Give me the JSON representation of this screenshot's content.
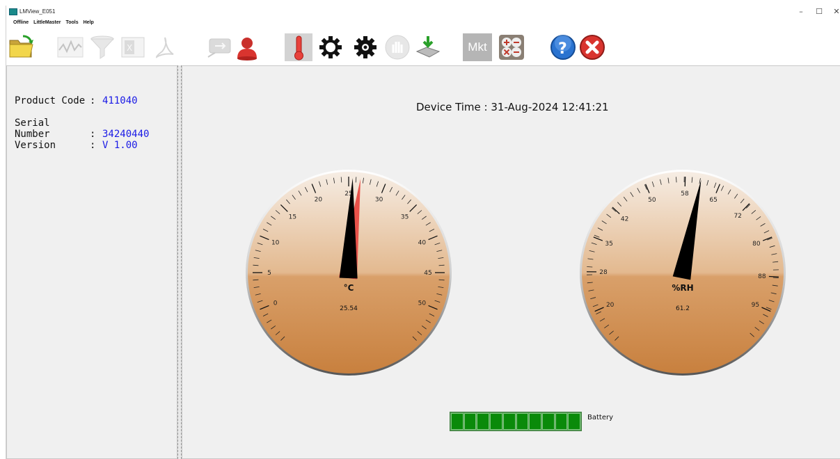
{
  "window": {
    "title": "LMView_E051",
    "minimize": "–",
    "maximize": "☐",
    "close": "✕"
  },
  "menu": [
    "Offline",
    "LittleMaster",
    "Tools",
    "Help"
  ],
  "toolbar": {
    "mkt_label": "Mkt",
    "help_glyph": "?",
    "items": [
      {
        "icon": "open-folder-icon",
        "enabled": true
      },
      {
        "icon": "graph-icon",
        "enabled": false
      },
      {
        "icon": "filter-icon",
        "enabled": false
      },
      {
        "icon": "excel-export-icon",
        "enabled": false
      },
      {
        "icon": "pdf-export-icon",
        "enabled": false
      },
      {
        "icon": "usb-device-icon",
        "enabled": false
      },
      {
        "icon": "user-icon",
        "enabled": true
      },
      {
        "icon": "thermometer-icon",
        "enabled": true,
        "active": true
      },
      {
        "icon": "settings-gear-icon",
        "enabled": true
      },
      {
        "icon": "settings-gear-filled-icon",
        "enabled": true
      },
      {
        "icon": "stop-hand-icon",
        "enabled": false
      },
      {
        "icon": "download-icon",
        "enabled": true
      },
      {
        "icon": "mkt-icon",
        "enabled": true
      },
      {
        "icon": "calculator-icon",
        "enabled": true
      },
      {
        "icon": "help-icon",
        "enabled": true
      },
      {
        "icon": "exit-icon",
        "enabled": true
      }
    ]
  },
  "device_info": [
    {
      "label": "Product Code",
      "value": "411040"
    },
    {
      "label": "Serial Number",
      "value": "34240440"
    },
    {
      "label": "Version",
      "value": "V 1.00"
    }
  ],
  "device_time": "Device Time : 31-Aug-2024 12:41:21",
  "gauges": [
    {
      "name": "temperature",
      "unit_label": "°C",
      "value_text": "25.54",
      "value": 25.54,
      "min": -5,
      "max": 55,
      "major_ticks": [
        0,
        5,
        10,
        15,
        20,
        25,
        30,
        35,
        40,
        45,
        50
      ],
      "needle_color": "#000000",
      "second_needle_color": "#e8524a",
      "second_value": 26.6
    },
    {
      "name": "humidity",
      "unit_label": "%RH",
      "value_text": "61.2",
      "value": 61.2,
      "min": 13,
      "max": 102,
      "major_ticks": [
        20,
        28,
        35,
        42,
        50,
        58,
        65,
        72,
        80,
        88,
        95
      ],
      "needle_color": "#000000"
    }
  ],
  "battery": {
    "label": "Battery",
    "cells": 10,
    "level_percent": 100,
    "color": "#0a8a0a"
  }
}
